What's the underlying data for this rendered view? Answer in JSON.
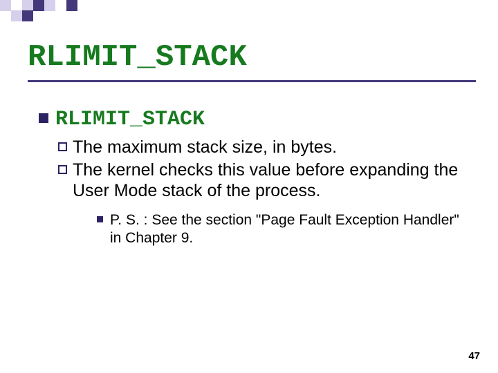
{
  "title": "RLIMIT_STACK",
  "level1": {
    "heading": "RLIMIT_STACK",
    "items": [
      "The maximum stack size, in bytes.",
      "The kernel checks this value before expanding the User Mode stack of the process."
    ],
    "subnote": "P. S. : See the section \"Page Fault Exception Handler\" in Chapter 9."
  },
  "page_number": "47",
  "colors": {
    "heading_green": "#177a1f",
    "accent_purple_dark": "#44377a",
    "accent_purple_light": "#d6d0ec"
  }
}
